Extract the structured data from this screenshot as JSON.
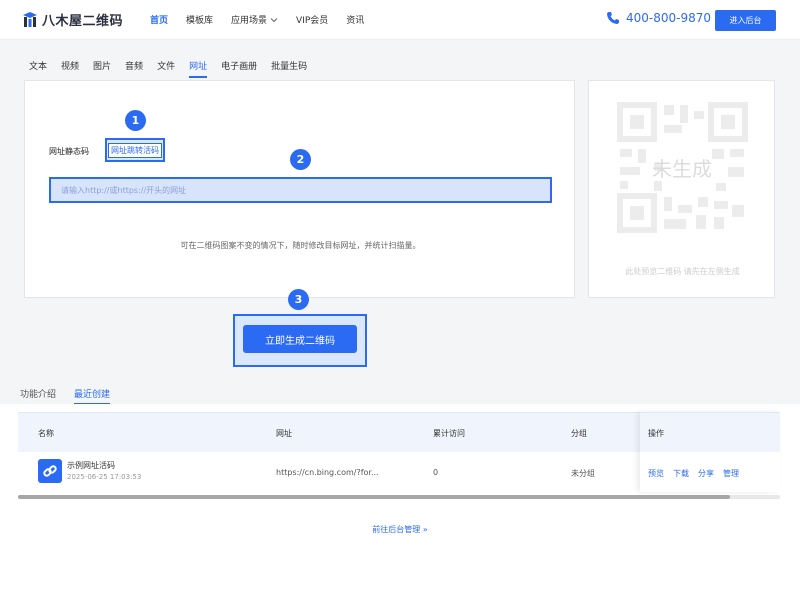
{
  "header": {
    "logo_text": "八木屋二维码",
    "nav": [
      {
        "label": "首页",
        "active": true
      },
      {
        "label": "模板库",
        "active": false
      },
      {
        "label": "应用场景",
        "active": false
      },
      {
        "label": "VIP会员",
        "active": false
      },
      {
        "label": "资讯",
        "active": false
      }
    ],
    "phone": "400-800-9870",
    "enter_button": "进入后台"
  },
  "tabs": [
    "文本",
    "视频",
    "图片",
    "音频",
    "文件",
    "网址",
    "电子画册",
    "批量生码"
  ],
  "active_tab": "网址",
  "panel": {
    "mode_static": "网址静态码",
    "mode_dynamic": "网址跳转活码",
    "url_placeholder": "请输入http://或https://开头的网址",
    "hint": "可在二维码图案不变的情况下，随时修改目标网址，并统计扫描量。",
    "badges": [
      "1",
      "2",
      "3"
    ]
  },
  "preview": {
    "status": "未生成",
    "note": "此处预览二维码 请先在左侧生成"
  },
  "generate_button": "立即生成二维码",
  "bottom_tabs": [
    {
      "label": "功能介绍",
      "active": false
    },
    {
      "label": "最近创建",
      "active": true
    }
  ],
  "table": {
    "headers": {
      "name": "名称",
      "url": "网址",
      "visits": "累计访问",
      "group": "分组",
      "actions": "操作"
    },
    "rows": [
      {
        "title": "示例网址活码",
        "date": "2025-06-25 17:03:53",
        "url": "https://cn.bing.com/?for...",
        "visits": "0",
        "group": "未分组",
        "actions": [
          "预览",
          "下载",
          "分享",
          "管理"
        ]
      }
    ]
  },
  "backlink": "前往后台管理 »",
  "colors": {
    "accent": "#2b6bf3",
    "highlight": "#dbe7fd"
  }
}
